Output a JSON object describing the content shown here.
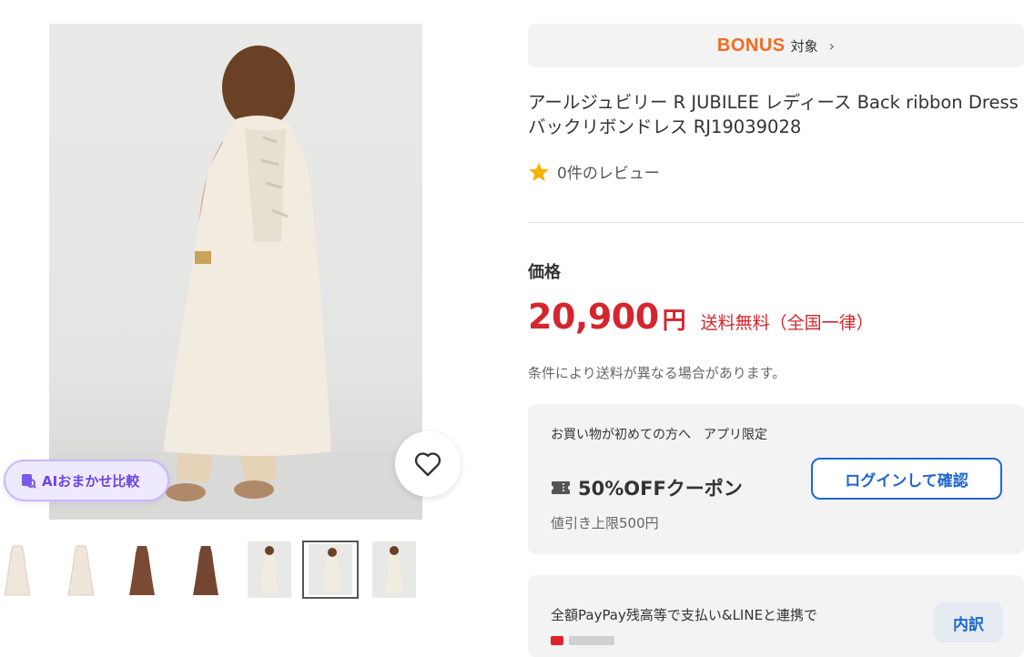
{
  "gallery": {
    "ai_button_label": "AIおまかせ比較",
    "thumbnails": [
      {
        "kind": "ivory-dress"
      },
      {
        "kind": "ivory-dress"
      },
      {
        "kind": "brown-dress"
      },
      {
        "kind": "brown-dress"
      },
      {
        "kind": "model-photo"
      },
      {
        "kind": "model-photo",
        "selected": true
      },
      {
        "kind": "model-photo"
      }
    ]
  },
  "bonus": {
    "logo": "BONUS",
    "label": "対象"
  },
  "product": {
    "title": "アールジュビリー R JUBILEE レディース Back ribbon Dress バックリボンドレス RJ19039028",
    "review_text": "0件のレビュー"
  },
  "price": {
    "label": "価格",
    "amount": "20,900",
    "currency": "円",
    "shipping": "送料無料（全国一律）",
    "condition_note": "条件により送料が異なる場合があります。"
  },
  "coupon": {
    "note": "お買い物が初めての方へ　アプリ限定",
    "title": "50%OFFクーポン",
    "limit": "値引き上限500円",
    "login_button": "ログインして確認"
  },
  "paypay": {
    "text": "全額PayPay残高等で支払い&LINEと連携で",
    "breakdown_button": "内訳"
  },
  "colors": {
    "price_red": "#d4262e",
    "link_blue": "#1f66d0",
    "bonus_orange": "#f26b1f",
    "ai_purple": "#6b45e0",
    "star_gold": "#f5b301"
  }
}
